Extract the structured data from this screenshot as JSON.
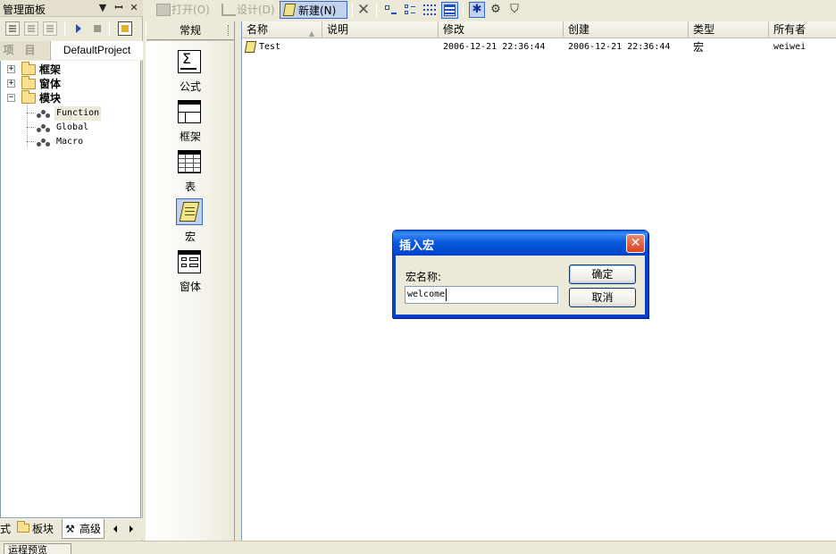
{
  "panel": {
    "title": "管理面板",
    "title_buttons": [
      "▼",
      "ꟷ",
      "✕"
    ],
    "tabs": {
      "project": "项目",
      "default_project": "DefaultProject"
    },
    "tree": {
      "folders": [
        "框架",
        "窗体",
        "模块"
      ],
      "modules": [
        "Function",
        "Global",
        "Macro"
      ]
    },
    "bottom_tabs": {
      "partial": "式",
      "blocks": "板块",
      "advanced": "高级"
    }
  },
  "toolbar": {
    "open": "打开(O)",
    "design": "设计(D)",
    "new": "新建(N)"
  },
  "object_bar": {
    "header": "常规",
    "items": [
      "公式",
      "框架",
      "表",
      "宏",
      "窗体"
    ],
    "selected": "宏"
  },
  "list": {
    "columns": [
      "名称",
      "说明",
      "修改",
      "创建",
      "类型",
      "所有者"
    ],
    "rows": [
      {
        "name": "Test",
        "description": "",
        "modified": "2006-12-21 22:36:44",
        "created": "2006-12-21 22:36:44",
        "type": "宏",
        "owner": "weiwei"
      }
    ]
  },
  "status": {
    "tab": "运程预览"
  },
  "dialog": {
    "title": "插入宏",
    "label": "宏名称:",
    "input_value": "welcome",
    "ok": "确定",
    "cancel": "取消"
  },
  "colors": {
    "xp_blue": "#0042c8",
    "selection": "#c1d2ee",
    "close_red": "#d8431c"
  }
}
